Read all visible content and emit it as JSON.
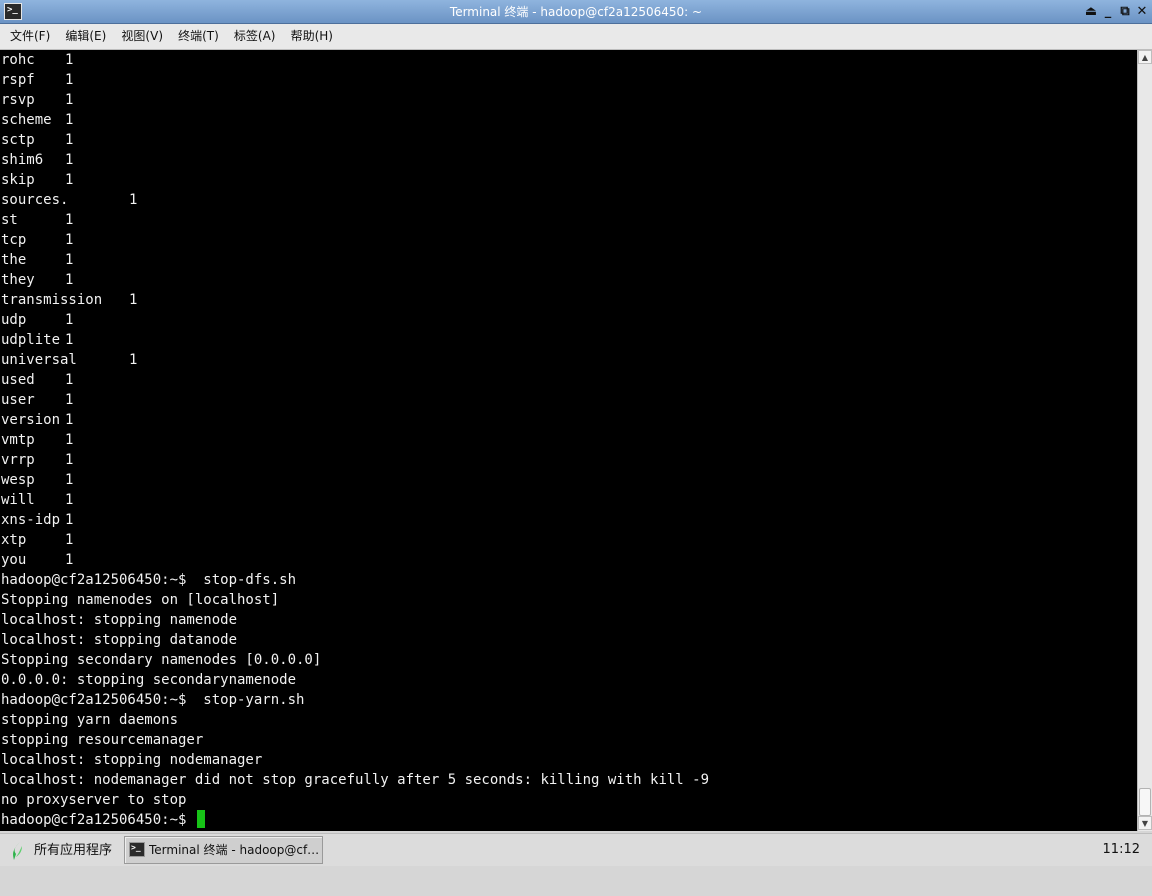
{
  "window": {
    "title": "Terminal 终端 - hadoop@cf2a12506450: ~",
    "app_icon": "terminal-icon",
    "controls": [
      "maximize-up-icon",
      "minimize-icon",
      "restore-icon",
      "close-icon"
    ],
    "control_glyphs": [
      "⏏",
      "_",
      "⧉",
      "✕"
    ]
  },
  "menubar": {
    "items": [
      {
        "label": "文件(F)"
      },
      {
        "label": "编辑(E)"
      },
      {
        "label": "视图(V)"
      },
      {
        "label": "终端(T)"
      },
      {
        "label": "标签(A)"
      },
      {
        "label": "帮助(H)"
      }
    ]
  },
  "terminal": {
    "word_counts": [
      {
        "word": "rohc",
        "count": "1"
      },
      {
        "word": "rspf",
        "count": "1"
      },
      {
        "word": "rsvp",
        "count": "1"
      },
      {
        "word": "scheme",
        "count": "1"
      },
      {
        "word": "sctp",
        "count": "1"
      },
      {
        "word": "shim6",
        "count": "1"
      },
      {
        "word": "skip",
        "count": "1"
      },
      {
        "word": "sources.",
        "count": "1"
      },
      {
        "word": "st",
        "count": "1"
      },
      {
        "word": "tcp",
        "count": "1"
      },
      {
        "word": "the",
        "count": "1"
      },
      {
        "word": "they",
        "count": "1"
      },
      {
        "word": "transmission",
        "count": "1"
      },
      {
        "word": "udp",
        "count": "1"
      },
      {
        "word": "udplite",
        "count": "1"
      },
      {
        "word": "universal",
        "count": "1"
      },
      {
        "word": "used",
        "count": "1"
      },
      {
        "word": "user",
        "count": "1"
      },
      {
        "word": "version",
        "count": "1"
      },
      {
        "word": "vmtp",
        "count": "1"
      },
      {
        "word": "vrrp",
        "count": "1"
      },
      {
        "word": "wesp",
        "count": "1"
      },
      {
        "word": "will",
        "count": "1"
      },
      {
        "word": "xns-idp",
        "count": "1"
      },
      {
        "word": "xtp",
        "count": "1"
      },
      {
        "word": "you",
        "count": "1"
      }
    ],
    "output_lines": [
      "hadoop@cf2a12506450:~$  stop-dfs.sh",
      "Stopping namenodes on [localhost]",
      "localhost: stopping namenode",
      "localhost: stopping datanode",
      "Stopping secondary namenodes [0.0.0.0]",
      "0.0.0.0: stopping secondarynamenode",
      "hadoop@cf2a12506450:~$  stop-yarn.sh",
      "stopping yarn daemons",
      "stopping resourcemanager",
      "localhost: stopping nodemanager",
      "localhost: nodemanager did not stop gracefully after 5 seconds: killing with kill -9",
      "no proxyserver to stop"
    ],
    "prompt": "hadoop@cf2a12506450:~$ ",
    "cursor_color": "#17c317"
  },
  "scrollbar": {
    "up_glyph": "▲",
    "down_glyph": "▼"
  },
  "taskbar": {
    "start_label": "所有应用程序",
    "start_icon": "leaf-logo-icon",
    "task_label": "Terminal 终端 - hadoop@cf…",
    "clock": "11:12"
  }
}
